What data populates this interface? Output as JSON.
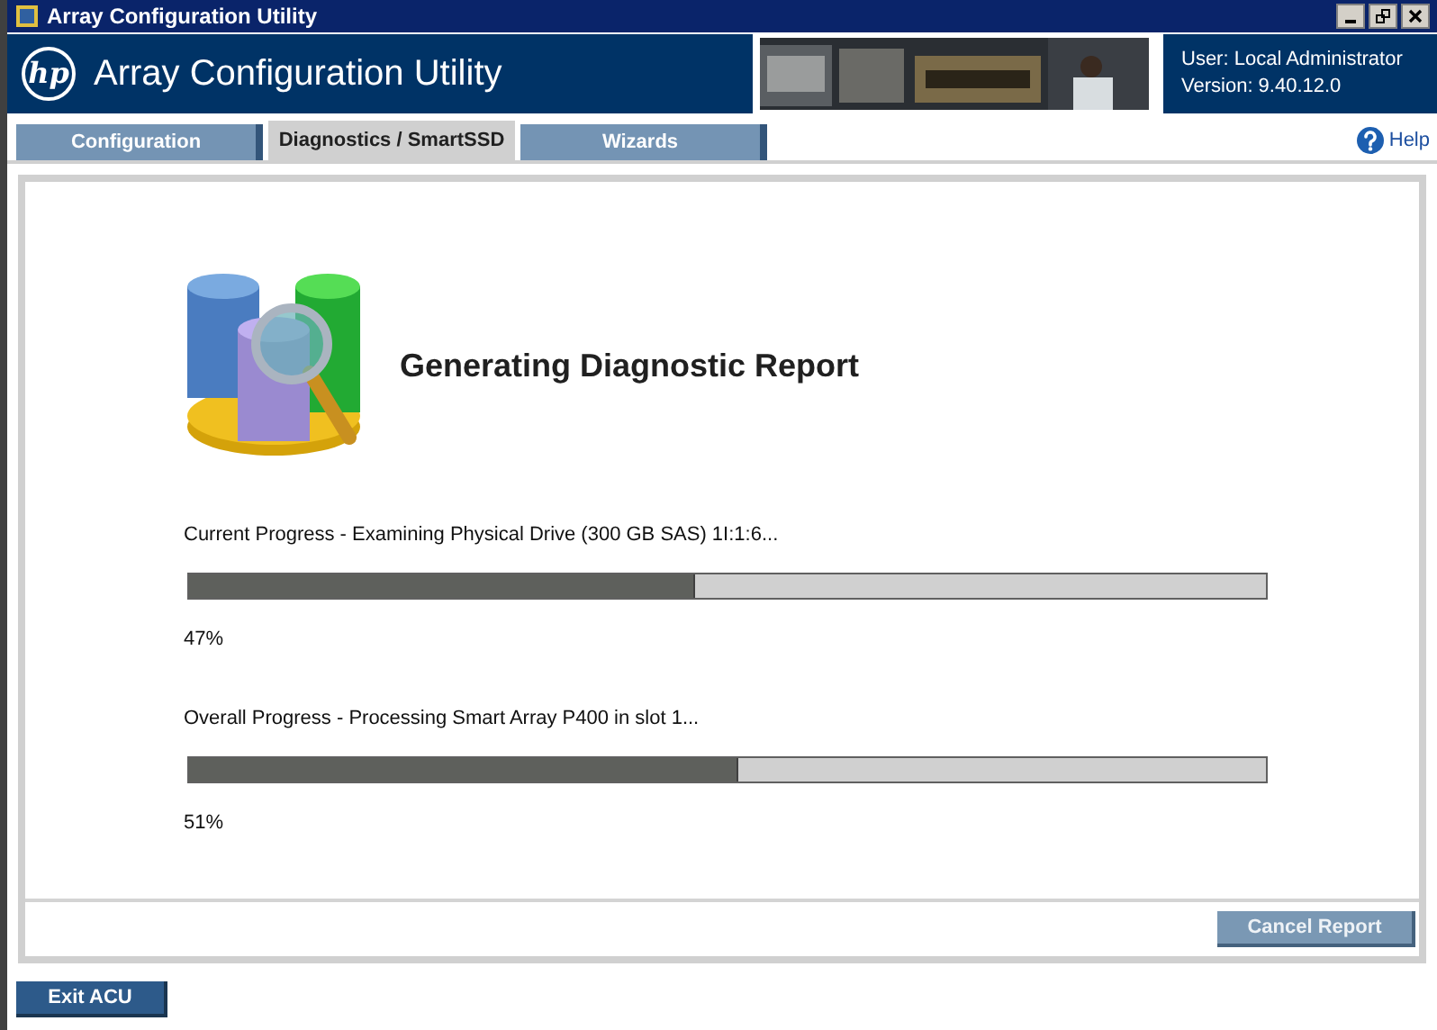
{
  "window": {
    "title": "Array Configuration Utility"
  },
  "header": {
    "logo": "hp",
    "title": "Array Configuration Utility",
    "user": "User: Local Administrator",
    "version": "Version: 9.40.12.0"
  },
  "tabs": [
    {
      "label": "Configuration",
      "selected": false
    },
    {
      "label": "Diagnostics / SmartSSD",
      "selected": true
    },
    {
      "label": "Wizards",
      "selected": false
    }
  ],
  "help": "Help",
  "report": {
    "heading": "Generating Diagnostic Report",
    "progress": [
      {
        "label": "Current Progress - Examining Physical Drive (300 GB SAS) 1I:1:6...",
        "level": 0.47,
        "reading": "47%"
      },
      {
        "label": "Overall Progress - Processing Smart Array P400 in slot 1...",
        "level": 0.51,
        "reading": "51%"
      }
    ]
  },
  "buttons": [
    {
      "label": "Cancel Report",
      "disabled": true
    },
    {
      "label": "Exit ACU",
      "disabled": false
    }
  ]
}
